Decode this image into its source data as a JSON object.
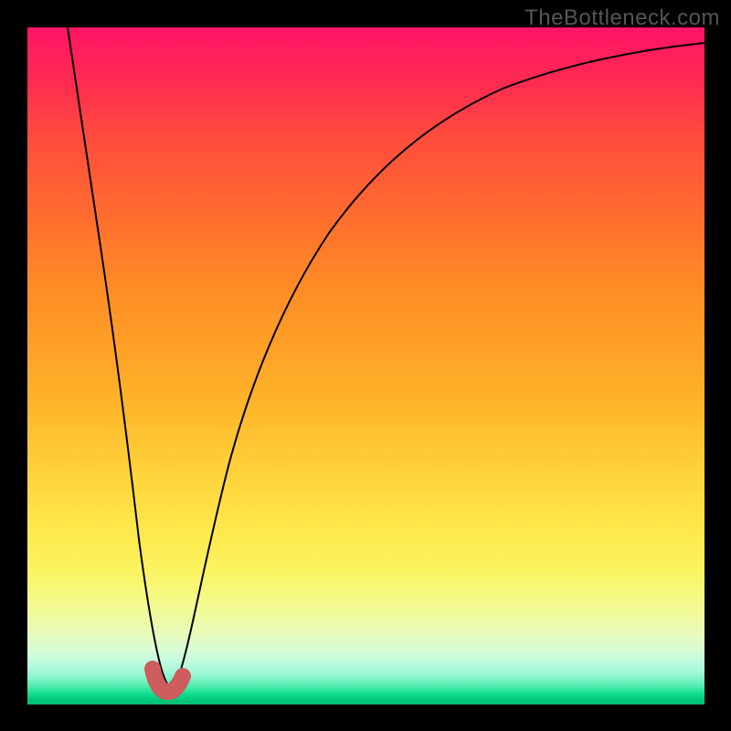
{
  "watermark": "TheBottleneck.com",
  "colors": {
    "background": "#000000",
    "curve": "#000000",
    "marker": "#cd5c5c"
  },
  "chart_data": {
    "type": "line",
    "title": "",
    "xlabel": "",
    "ylabel": "",
    "xlim": [
      0,
      1000
    ],
    "ylim": [
      0,
      1000
    ],
    "series": [
      {
        "name": "bottleneck-curve",
        "x": [
          60,
          70,
          80,
          90,
          100,
          110,
          120,
          130,
          140,
          150,
          160,
          170,
          180,
          190,
          200,
          210,
          220,
          230,
          240,
          260,
          280,
          300,
          330,
          370,
          420,
          480,
          560,
          660,
          780,
          900,
          1000
        ],
        "y": [
          1000,
          920,
          840,
          760,
          680,
          600,
          520,
          440,
          360,
          280,
          200,
          130,
          70,
          30,
          10,
          15,
          40,
          90,
          150,
          260,
          350,
          430,
          520,
          600,
          670,
          730,
          790,
          840,
          880,
          915,
          940
        ]
      }
    ],
    "annotations": [
      {
        "name": "cusp-marker",
        "x_range": [
          170,
          215
        ],
        "y_approx": 13
      }
    ],
    "gradient_background": {
      "direction": "top-to-bottom",
      "stops": [
        {
          "pos": 0.0,
          "color": "#ff1468"
        },
        {
          "pos": 0.5,
          "color": "#ffb029"
        },
        {
          "pos": 0.8,
          "color": "#fbf35f"
        },
        {
          "pos": 1.0,
          "color": "#01be72"
        }
      ]
    }
  }
}
